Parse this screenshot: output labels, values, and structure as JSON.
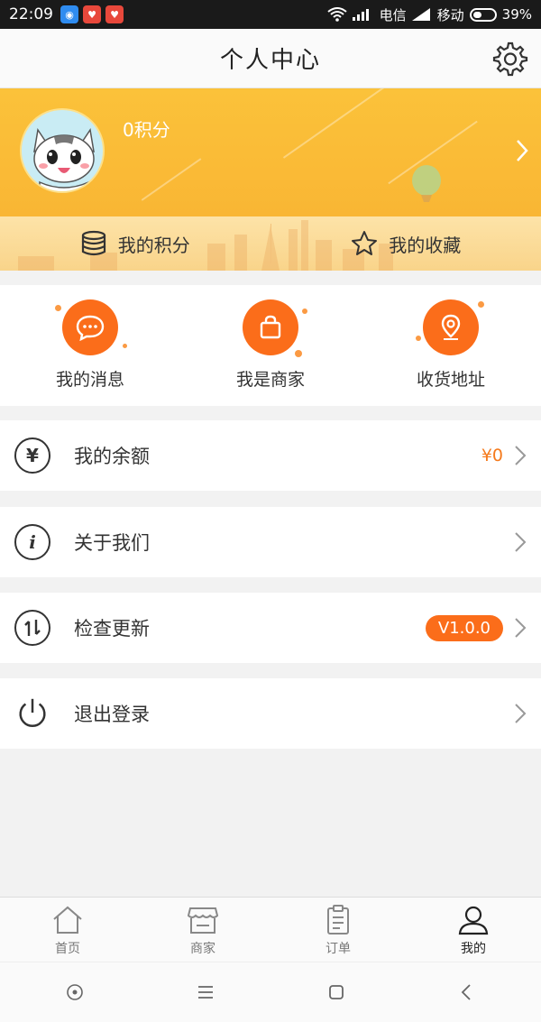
{
  "status_bar": {
    "time": "22:09",
    "network_label_1": "电信",
    "network_label_2": "移动",
    "battery": "39%"
  },
  "header": {
    "title": "个人中心",
    "settings_icon": "gear-icon"
  },
  "profile": {
    "points_text": "0积分",
    "avatar_icon": "cat-avatar"
  },
  "shortcuts": {
    "points_label": "我的积分",
    "favorites_label": "我的收藏"
  },
  "quick_actions": [
    {
      "label": "我的消息",
      "icon": "message-icon"
    },
    {
      "label": "我是商家",
      "icon": "shopping-bag-icon"
    },
    {
      "label": "收货地址",
      "icon": "location-pin-icon"
    }
  ],
  "menu": {
    "balance": {
      "label": "我的余额",
      "value": "¥0"
    },
    "about": {
      "label": "关于我们"
    },
    "update": {
      "label": "检查更新",
      "version": "V1.0.0"
    },
    "logout": {
      "label": "退出登录"
    }
  },
  "tabbar": {
    "tabs": [
      {
        "label": "首页",
        "icon": "home-icon"
      },
      {
        "label": "商家",
        "icon": "store-icon"
      },
      {
        "label": "订单",
        "icon": "clipboard-icon"
      },
      {
        "label": "我的",
        "icon": "person-icon"
      }
    ],
    "active_tab": "我的"
  },
  "colors": {
    "accent": "#fb6d1a",
    "banner": "#fbc23a",
    "value_text": "#f57a1c"
  }
}
